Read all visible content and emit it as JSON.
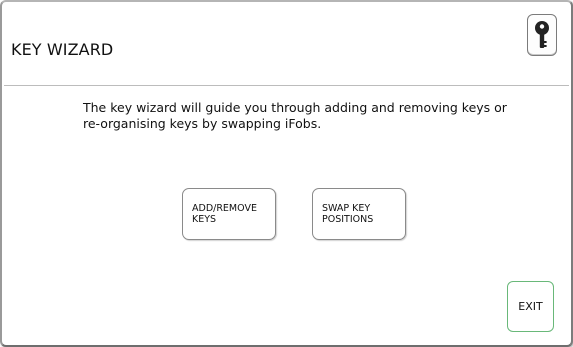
{
  "header": {
    "title": "KEY WIZARD",
    "key_icon": "key-icon"
  },
  "main": {
    "intro_text": "The key wizard will guide you through adding and removing keys or re-organising keys by swapping iFobs.",
    "buttons": [
      {
        "label": "ADD/REMOVE\nKEYS"
      },
      {
        "label": "SWAP KEY\nPOSITIONS"
      }
    ]
  },
  "footer": {
    "exit_label": "EXIT"
  },
  "colors": {
    "exit_border": "#69b879",
    "border": "#8a8a8a"
  }
}
